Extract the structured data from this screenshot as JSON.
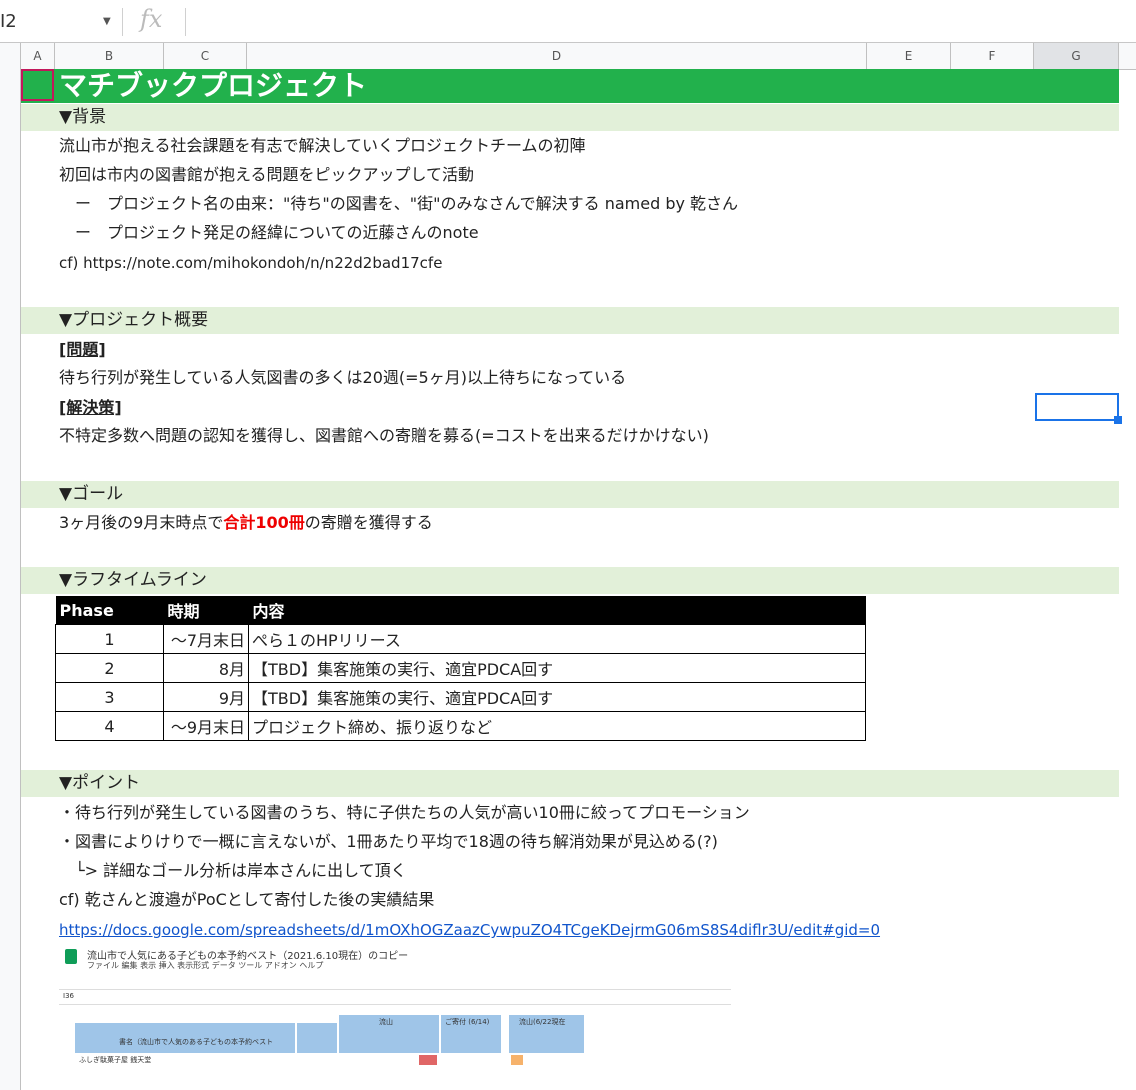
{
  "formula_bar": {
    "cell_ref": "I2",
    "fx_label": "fx"
  },
  "columns": [
    "A",
    "B",
    "C",
    "D",
    "E",
    "F",
    "G"
  ],
  "title": "マチブックプロジェクト",
  "sections": {
    "background": {
      "heading": "▼背景",
      "lines": [
        "流山市が抱える社会課題を有志で解決していくプロジェクトチームの初陣",
        "初回は市内の図書館が抱える問題をピックアップして活動",
        "　ー　プロジェクト名の由来：\"待ち\"の図書を、\"街\"のみなさんで解決する named by 乾さん",
        "　ー　プロジェクト発足の経緯についての近藤さんのnote",
        "cf) https://note.com/mihokondoh/n/n22d2bad17cfe"
      ]
    },
    "overview": {
      "heading": "▼プロジェクト概要",
      "problem_label": "[問題]",
      "problem": "待ち行列が発生している人気図書の多くは20週(=5ヶ月)以上待ちになっている",
      "solution_label": "[解決策]",
      "solution": "不特定多数へ問題の認知を獲得し、図書館への寄贈を募る(=コストを出来るだけかけない)"
    },
    "goal": {
      "heading": "▼ゴール",
      "text_before": "3ヶ月後の9月末時点で",
      "text_highlight": "合計100冊",
      "text_after": "の寄贈を獲得する"
    },
    "timeline": {
      "heading": "▼ラフタイムライン",
      "headers": [
        "Phase",
        "時期",
        "内容"
      ],
      "rows": [
        [
          "1",
          "〜7月末日",
          "ぺら１のHPリリース"
        ],
        [
          "2",
          "8月",
          "【TBD】集客施策の実行、適宜PDCA回す"
        ],
        [
          "3",
          "9月",
          "【TBD】集客施策の実行、適宜PDCA回す"
        ],
        [
          "4",
          "〜9月末日",
          "プロジェクト締め、振り返りなど"
        ]
      ]
    },
    "points": {
      "heading": "▼ポイント",
      "lines": [
        "・待ち行列が発生している図書のうち、特に子供たちの人気が高い10冊に絞ってプロモーション",
        "・図書によりけりで一概に言えないが、1冊あたり平均で18週の待ち解消効果が見込める(?)",
        "　└> 詳細なゴール分析は岸本さんに出して頂く",
        "cf) 乾さんと渡邉がPoCとして寄付した後の実績結果"
      ],
      "link": "https://docs.google.com/spreadsheets/d/1mOXhOGZaazCywpuZO4TCgeKDejrmG06mS8S4diflr3U/edit#gid=0"
    }
  },
  "thumbnail": {
    "title": "流山市で人気にある子どもの本予約ベスト（2021.6.10現在）のコピー",
    "menu": "ファイル  編集  表示  挿入  表示形式  データ  ツール  アドオン  ヘルプ",
    "name_box": "I36",
    "col_b_header": "書名（流山市で人気のある子どもの本予約ベスト",
    "group_1": "流山",
    "group_2": "ご寄付 (6/14)",
    "group_3": "流山(6/22現在",
    "first_row": "ふしぎ駄菓子屋 銭天堂"
  },
  "colors": {
    "title_band": "#22b14c",
    "section_band": "#e2f0d9",
    "highlight_red": "#ee0000",
    "link_blue": "#1155cc",
    "selection_blue": "#1a73e8"
  }
}
